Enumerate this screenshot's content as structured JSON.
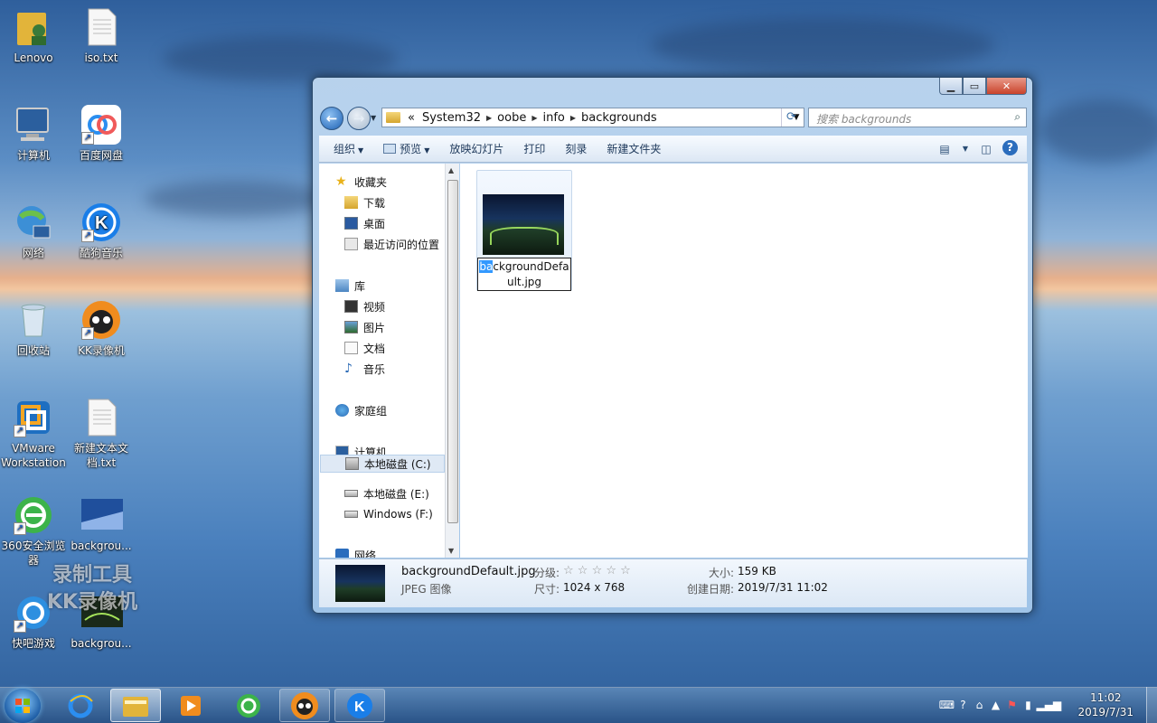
{
  "desktop": {
    "icons": [
      {
        "label": "Lenovo",
        "icon": "user-folder-icon"
      },
      {
        "label": "iso.txt",
        "icon": "text-file-icon"
      },
      {
        "label": "计算机",
        "icon": "computer-icon"
      },
      {
        "label": "百度网盘",
        "icon": "baidu-netdisk-icon"
      },
      {
        "label": "网络",
        "icon": "network-icon"
      },
      {
        "label": "酷狗音乐",
        "icon": "kugou-music-icon"
      },
      {
        "label": "回收站",
        "icon": "recycle-bin-icon"
      },
      {
        "label": "KK录像机",
        "icon": "kk-recorder-icon"
      },
      {
        "label": "VMware Workstation",
        "icon": "vmware-icon"
      },
      {
        "label": "新建文本文档.txt",
        "icon": "text-file-icon"
      },
      {
        "label": "360安全浏览器",
        "icon": "360-browser-icon"
      },
      {
        "label": "backgrou...",
        "icon": "image-file-icon"
      },
      {
        "label": "快吧游戏",
        "icon": "kuaiba-game-icon"
      },
      {
        "label": "backgrou...",
        "icon": "image-file-icon"
      }
    ],
    "watermark_line1": "录制工具",
    "watermark_line2": "KK录像机"
  },
  "window": {
    "breadcrumb": {
      "prefix": "«",
      "segments": [
        "System32",
        "oobe",
        "info",
        "backgrounds"
      ]
    },
    "search_placeholder": "搜索 backgrounds",
    "toolbar": {
      "organize": "组织",
      "preview": "预览",
      "slideshow": "放映幻灯片",
      "print": "打印",
      "burn": "刻录",
      "new_folder": "新建文件夹"
    },
    "nav": {
      "favorites": "收藏夹",
      "downloads": "下载",
      "desktop": "桌面",
      "recent": "最近访问的位置",
      "libraries": "库",
      "videos": "视频",
      "pictures": "图片",
      "documents": "文档",
      "music": "音乐",
      "homegroup": "家庭组",
      "computer": "计算机",
      "drive_c": "本地磁盘 (C:)",
      "drive_e": "本地磁盘 (E:)",
      "drive_f": "Windows (F:)",
      "network": "网络"
    },
    "file": {
      "name_selected": "ba",
      "name_rest_line1": "ckgroundDefa",
      "name_line2": "ult.jpg"
    },
    "details": {
      "filename": "backgroundDefault.jpg",
      "filetype": "JPEG 图像",
      "rating_label": "分级:",
      "rating_stars": "☆ ☆ ☆ ☆ ☆",
      "dimensions_label": "尺寸:",
      "dimensions": "1024 x 768",
      "size_label": "大小:",
      "size": "159 KB",
      "created_label": "创建日期:",
      "created": "2019/7/31 11:02"
    }
  },
  "taskbar": {
    "time": "11:02",
    "date": "2019/7/31"
  }
}
